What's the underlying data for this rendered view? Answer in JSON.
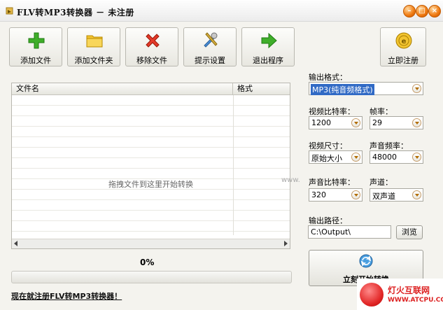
{
  "window": {
    "title": "FLV转MP3转换器 － 未注册"
  },
  "toolbar": {
    "add_file": "添加文件",
    "add_folder": "添加文件夹",
    "remove_file": "移除文件",
    "prompt_settings": "提示设置",
    "exit_program": "退出程序",
    "register_now": "立即注册"
  },
  "file_list": {
    "columns": [
      "文件名",
      "格式"
    ],
    "drop_hint": "拖拽文件到这里开始转换"
  },
  "progress": {
    "text": "0%",
    "value": 0
  },
  "register_link": "现在就注册FLV转MP3转换器！",
  "settings": {
    "output_format_label": "输出格式：",
    "output_format_value": "MP3(纯音频格式)",
    "video_bitrate_label": "视频比特率：",
    "video_bitrate_value": "1200",
    "frame_rate_label": "帧率：",
    "frame_rate_value": "29",
    "video_size_label": "视频尺寸：",
    "video_size_value": "原始大小",
    "audio_freq_label": "声音频率：",
    "audio_freq_value": "48000",
    "audio_bitrate_label": "声音比特率：",
    "audio_bitrate_value": "320",
    "channel_label": "声道：",
    "channel_value": "双声道",
    "output_path_label": "输出路径：",
    "output_path_value": "C:\\Output\\",
    "browse": "浏览",
    "start_convert": "立刻开始转换"
  },
  "overlay_url": "www.",
  "watermark": {
    "name": "灯火互联网",
    "url": "WWW.ATCPU.COM"
  },
  "colors": {
    "accent_orange": "#f07a10",
    "selection_blue": "#316ac5"
  }
}
